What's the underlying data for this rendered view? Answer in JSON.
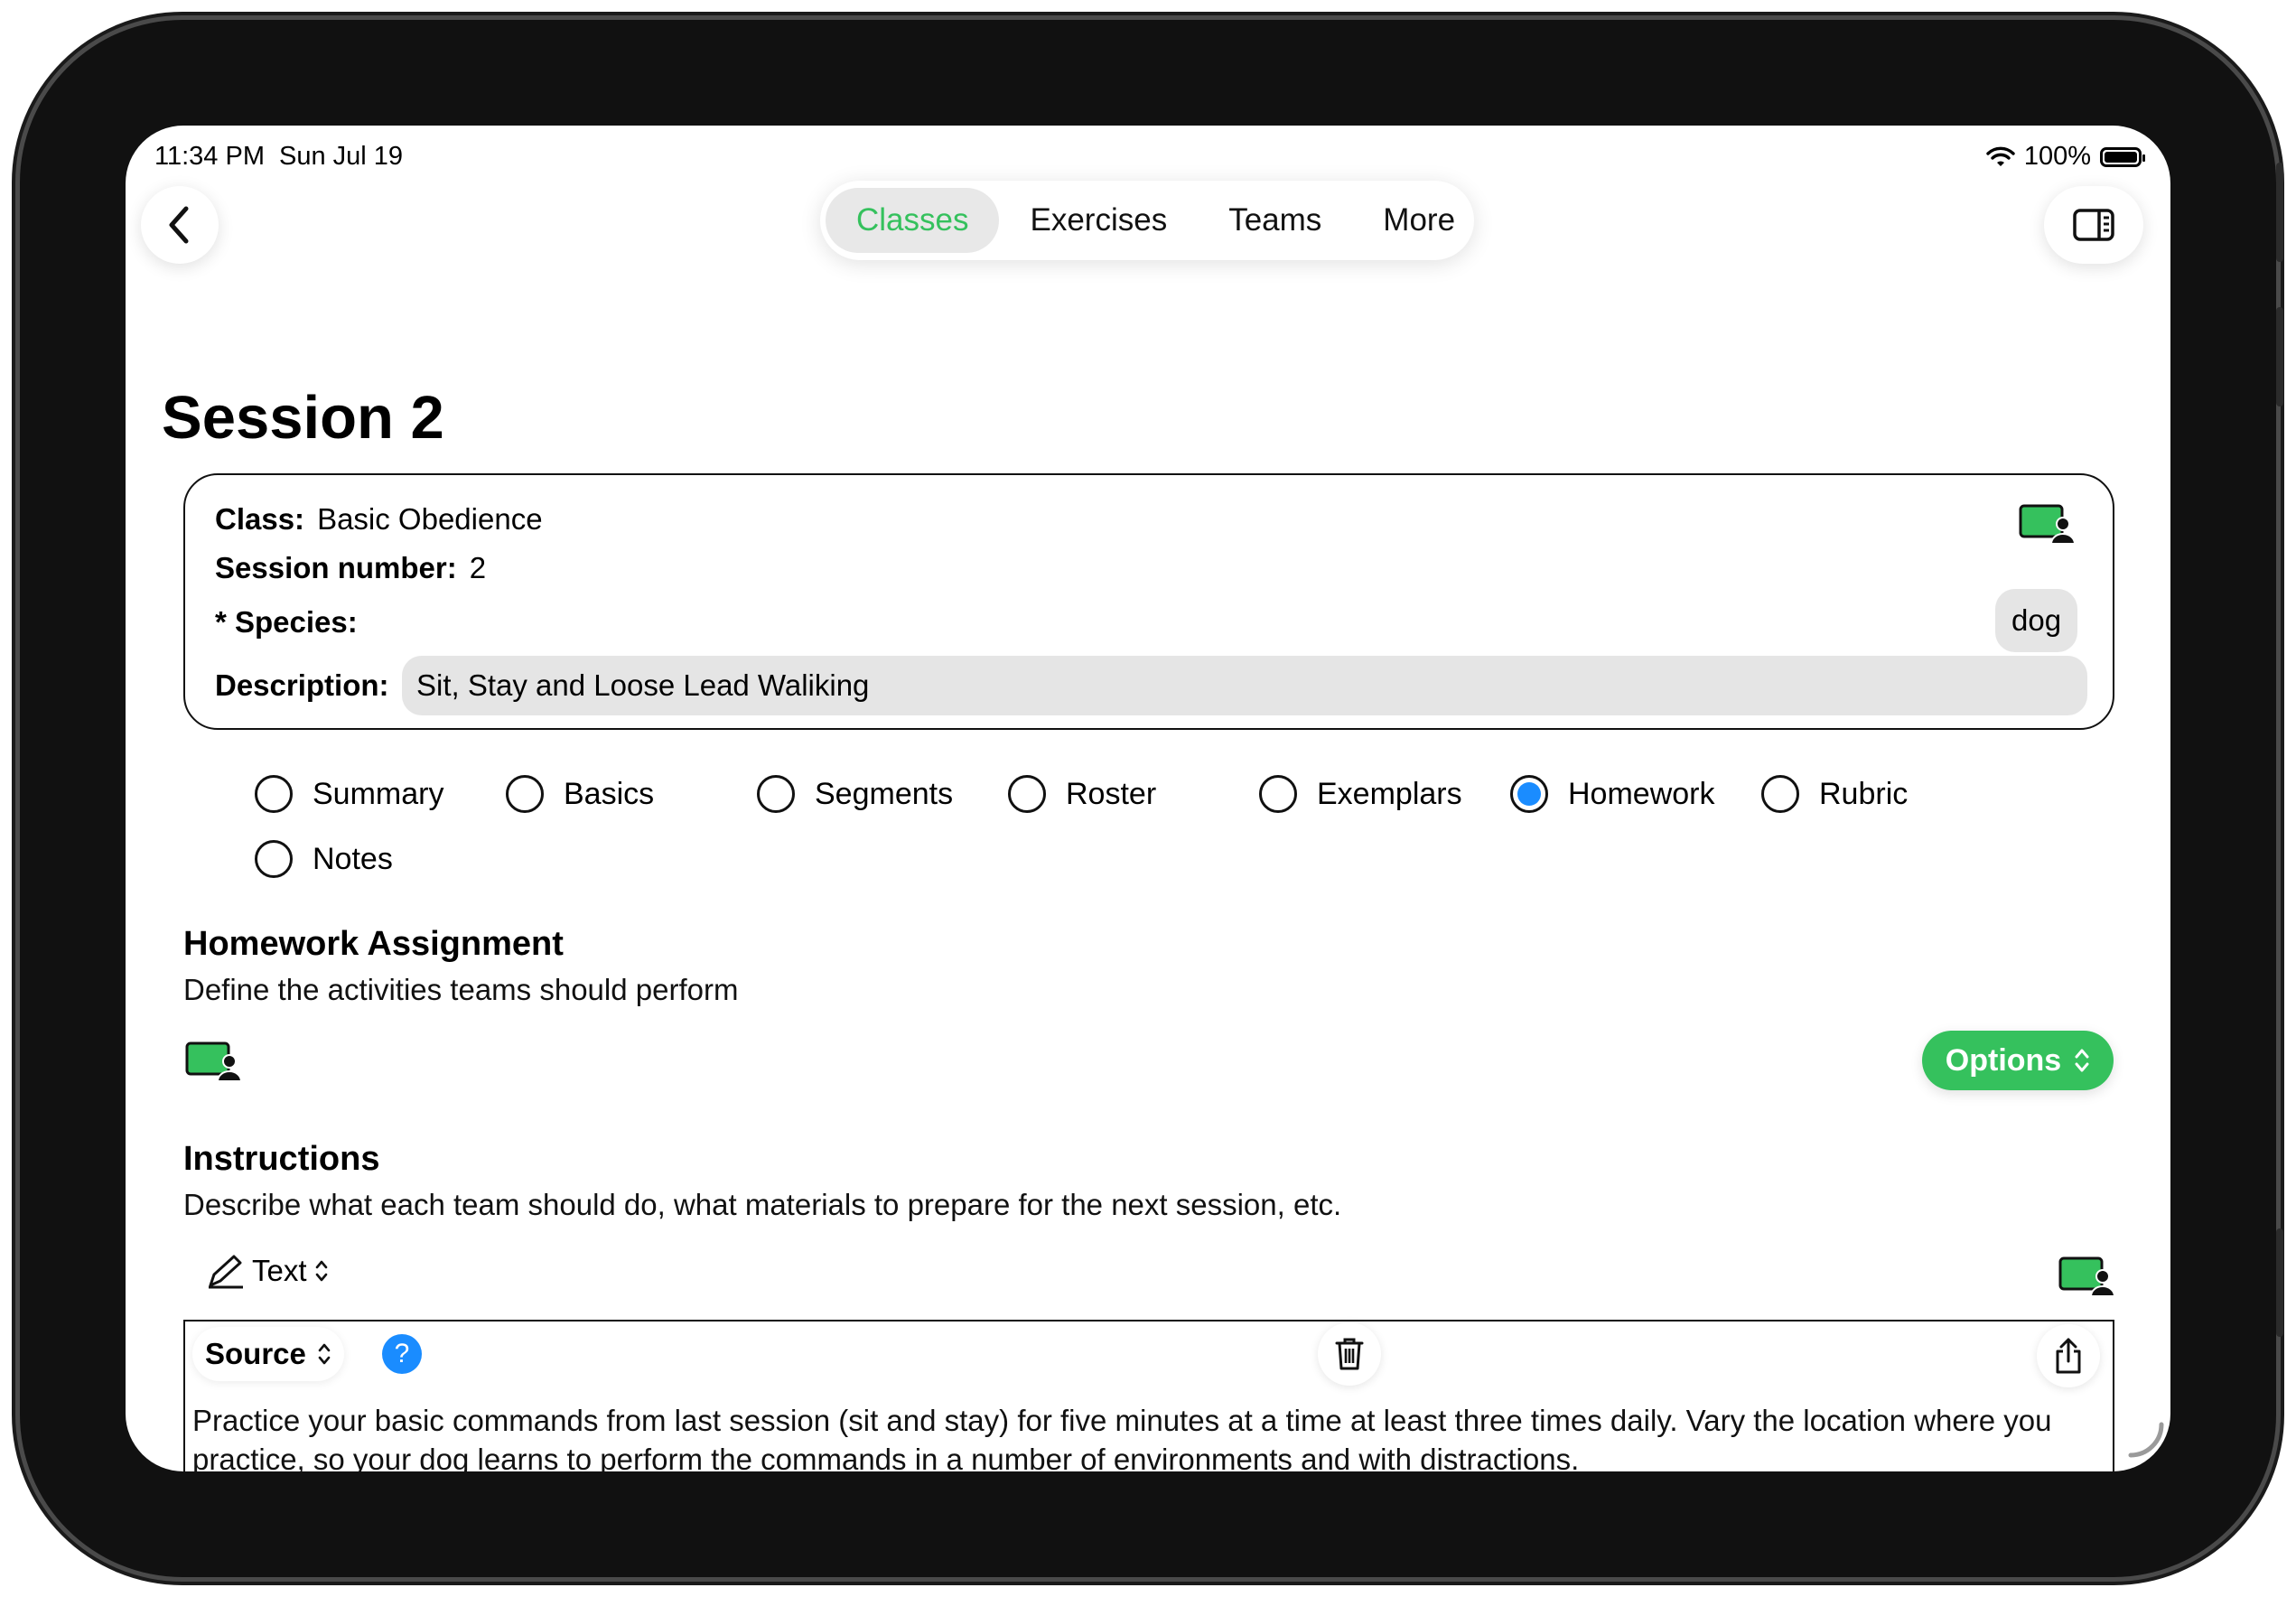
{
  "status_bar": {
    "time": "11:34 PM",
    "date": "Sun Jul 19",
    "battery": "100%"
  },
  "nav": {
    "tabs": [
      {
        "label": "Classes",
        "active": true
      },
      {
        "label": "Exercises",
        "active": false
      },
      {
        "label": "Teams",
        "active": false
      },
      {
        "label": "More",
        "active": false
      }
    ]
  },
  "page": {
    "title": "Session 2"
  },
  "info": {
    "class_label": "Class:",
    "class_value": "Basic Obedience",
    "session_label": "Session number:",
    "session_value": "2",
    "species_label": "* Species:",
    "species_value": "dog",
    "description_label": "Description:",
    "description_value": "Sit, Stay and Loose Lead Waliking"
  },
  "sections": [
    {
      "label": "Summary",
      "selected": false
    },
    {
      "label": "Basics",
      "selected": false
    },
    {
      "label": "Segments",
      "selected": false
    },
    {
      "label": "Roster",
      "selected": false
    },
    {
      "label": "Exemplars",
      "selected": false
    },
    {
      "label": "Homework",
      "selected": true
    },
    {
      "label": "Rubric",
      "selected": false
    },
    {
      "label": "Notes",
      "selected": false
    }
  ],
  "homework": {
    "title": "Homework Assignment",
    "subtitle": "Define the activities teams should perform",
    "options_label": "Options"
  },
  "instructions": {
    "title": "Instructions",
    "subtitle": "Describe what each team should do, what materials to prepare for the next session, etc.",
    "mode_label": "Text",
    "source_label": "Source",
    "help_label": "?",
    "body": "Practice your basic commands from last session (sit and stay) for five minutes at a time at least three times daily. Vary the location where you practice, so your dog learns to perform the commands in a number of environments and with distractions."
  },
  "colors": {
    "accent_green": "#35c15d",
    "selected_blue": "#1a8cff"
  }
}
